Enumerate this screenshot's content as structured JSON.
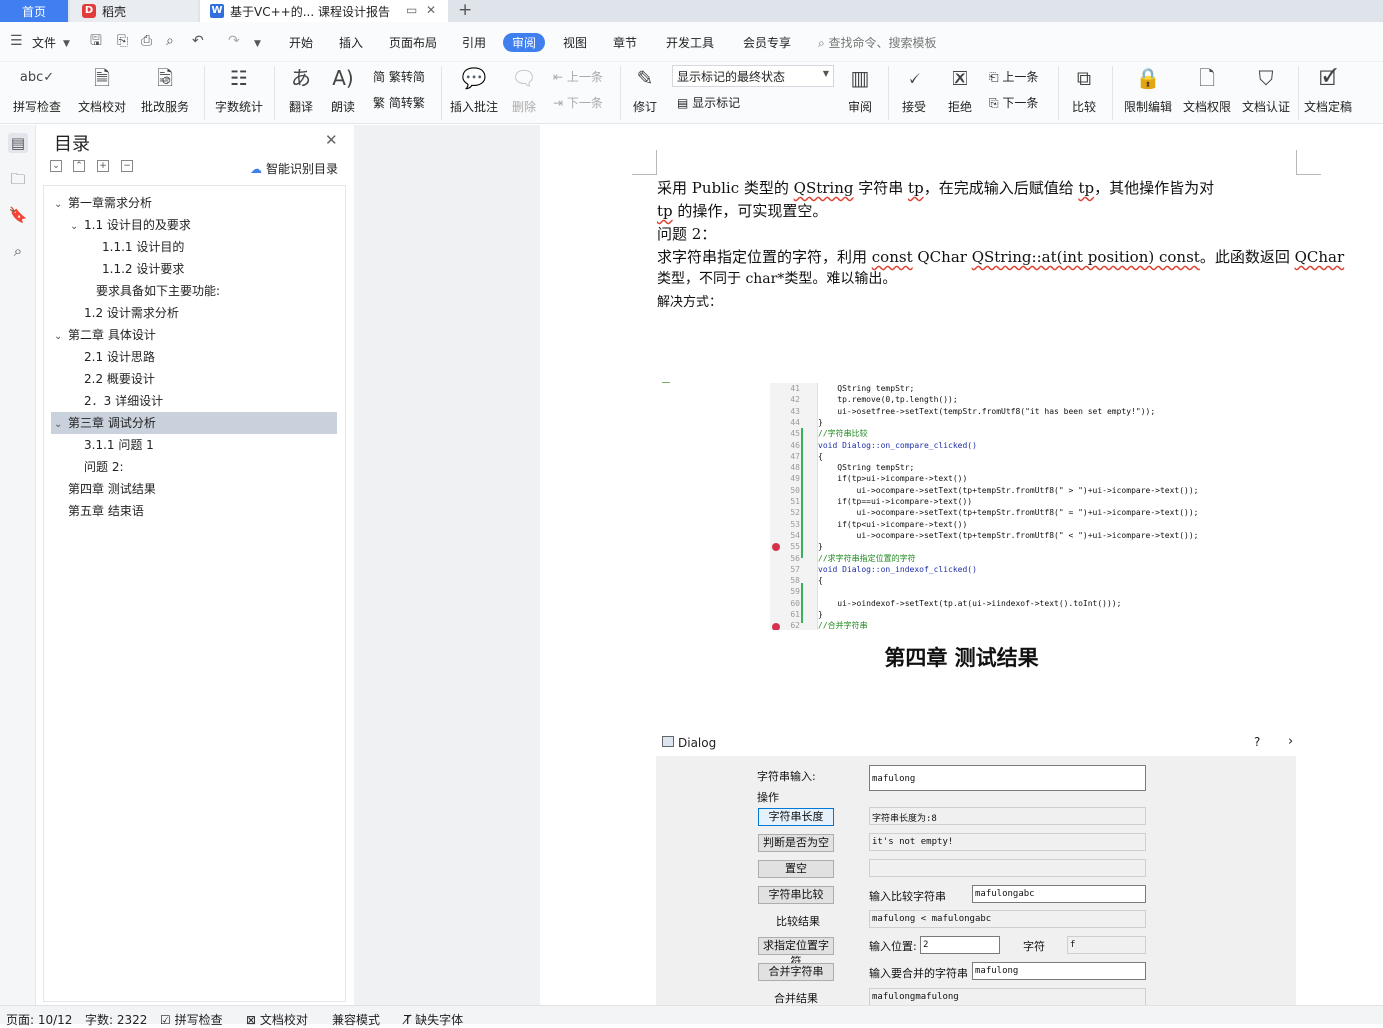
{
  "tabs": {
    "home": "首页",
    "daoke": "稻壳",
    "doc": "基于VC++的... 课程设计报告",
    "add": "+"
  },
  "menu": {
    "file": "文件",
    "items": [
      "开始",
      "插入",
      "页面布局",
      "引用",
      "审阅",
      "视图",
      "章节",
      "开发工具",
      "会员专享"
    ],
    "search": "查找命令、搜索模板"
  },
  "ribbon": {
    "spell_check": "拼写检查",
    "doc_proof": "文档校对",
    "revise_service": "批改服务",
    "word_count": "字数统计",
    "translate": "翻译",
    "read_aloud": "朗读",
    "trad_to_simp": "繁转简",
    "simp_to_trad": "简转繁",
    "insert_comment": "插入批注",
    "delete": "删除",
    "prev_comment": "上一条",
    "next_comment": "下一条",
    "track_changes": "修订",
    "markup_state": "显示标记的最终状态",
    "show_markup": "显示标记",
    "review_pane": "审阅",
    "accept": "接受",
    "reject": "拒绝",
    "prev_change": "上一条",
    "next_change": "下一条",
    "compare": "比较",
    "restrict_edit": "限制编辑",
    "doc_permission": "文档权限",
    "doc_certify": "文档认证",
    "doc_finalize": "文档定稿"
  },
  "toc": {
    "title": "目录",
    "smart": "智能识别目录",
    "items": [
      {
        "label": "第一章需求分析",
        "level": 0,
        "caret": "⌄"
      },
      {
        "label": "1.1 设计目的及要求",
        "level": 1,
        "caret": "⌄"
      },
      {
        "label": "1.1.1 设计目的",
        "level": 2,
        "caret": ""
      },
      {
        "label": "1.1.2 设计要求",
        "level": 2,
        "caret": ""
      },
      {
        "label": "要求具备如下主要功能:",
        "level": 3,
        "caret": ""
      },
      {
        "label": "1.2 设计需求分析",
        "level": 1,
        "caret": ""
      },
      {
        "label": "第二章  具体设计",
        "level": 0,
        "caret": "⌄"
      },
      {
        "label": "2.1 设计思路",
        "level": 1,
        "caret": ""
      },
      {
        "label": "2.2 概要设计",
        "level": 1,
        "caret": ""
      },
      {
        "label": "2．3 详细设计",
        "level": 1,
        "caret": ""
      },
      {
        "label": "第三章  调试分析",
        "level": 0,
        "caret": "⌄",
        "selected": true
      },
      {
        "label": "3.1.1 问题 1",
        "level": 1,
        "caret": ""
      },
      {
        "label": "问题 2:",
        "level": 1,
        "caret": ""
      },
      {
        "label": "第四章  测试结果",
        "level": 0,
        "caret": ""
      },
      {
        "label": "第五章  结束语",
        "level": 0,
        "caret": ""
      }
    ]
  },
  "doc": {
    "p1a_1": "采用 Public 类型的 ",
    "p1a_2": "QString",
    "p1a_3": " 字符串 ",
    "p1a_4": "tp",
    "p1a_5": "，在完成输入后赋值给 ",
    "p1a_6": "tp",
    "p1a_7": "，其他操作皆为对",
    "p1b_1": "tp",
    "p1b_2": " 的操作，可实现置空。",
    "q2": "问题 2：",
    "p2a_1": "求字符串指定位置的字符，利用 ",
    "p2a_2": "const",
    "p2a_3": " QChar ",
    "p2a_4": "QString::at(int position) const",
    "p2a_5": "。此函数返回 ",
    "p2a_6": "QChar",
    "p2b": "类型，不同于 char*类型。难以输出。",
    "solution": "解决方式：",
    "chapter4": "第四章  测试结果"
  },
  "code": [
    {
      "ln": "41",
      "t": "    QString tempStr;"
    },
    {
      "ln": "42",
      "t": "    tp.remove(0,tp.length());"
    },
    {
      "ln": "43",
      "t": "    ui->osetfree->setText(tempStr.fromUtf8(\"it has been set empty!\"));"
    },
    {
      "ln": "44",
      "t": "}"
    },
    {
      "ln": "45",
      "t": "//字符串比较"
    },
    {
      "ln": "46",
      "t": "void Dialog::on_compare_clicked()"
    },
    {
      "ln": "47",
      "t": "{"
    },
    {
      "ln": "48",
      "t": "    QString tempStr;"
    },
    {
      "ln": "49",
      "t": "    if(tp>ui->icompare->text())"
    },
    {
      "ln": "50",
      "t": "        ui->ocompare->setText(tp+tempStr.fromUtf8(\" > \")+ui->icompare->text());"
    },
    {
      "ln": "51",
      "t": "    if(tp==ui->icompare->text())"
    },
    {
      "ln": "52",
      "t": "        ui->ocompare->setText(tp+tempStr.fromUtf8(\" = \")+ui->icompare->text());"
    },
    {
      "ln": "53",
      "t": "    if(tp<ui->icompare->text())"
    },
    {
      "ln": "54",
      "t": "        ui->ocompare->setText(tp+tempStr.fromUtf8(\" < \")+ui->icompare->text());"
    },
    {
      "ln": "55",
      "t": "}"
    },
    {
      "ln": "56",
      "t": "//求字符串指定位置的字符"
    },
    {
      "ln": "57",
      "t": "void Dialog::on_indexof_clicked()"
    },
    {
      "ln": "58",
      "t": "{"
    },
    {
      "ln": "59",
      "t": ""
    },
    {
      "ln": "60",
      "t": "    ui->oindexof->setText(tp.at(ui->iindexof->text().toInt()));"
    },
    {
      "ln": "61",
      "t": "}"
    },
    {
      "ln": "62",
      "t": "//合并字符串"
    }
  ],
  "dialog": {
    "title": "Dialog",
    "help": "?",
    "close": "›",
    "input_label": "字符串输入:",
    "input_value": "mafulong",
    "ops_label": "操作",
    "btn_length": "字符串长度",
    "out_length": "字符串长度为:8",
    "btn_empty": "判断是否为空",
    "out_empty": "it's not empty!",
    "btn_clear": "置空",
    "out_clear": "",
    "btn_compare": "字符串比较",
    "compare_label": "输入比较字符串",
    "compare_value": "mafulongabc",
    "result_label": "比较结果",
    "result_value": "mafulong < mafulongabc",
    "btn_index": "求指定位置字符",
    "pos_label": "输入位置:",
    "pos_value": "2",
    "char_label": "字符",
    "char_value": "f",
    "btn_merge": "合并字符串",
    "merge_label": "输入要合并的字符串",
    "merge_value": "mafulong",
    "merged_label": "合并结果",
    "merged_value": "mafulongmafulong"
  },
  "status": {
    "page": "页面: 10/12",
    "words": "字数: 2322",
    "spell": "拼写检查",
    "proof": "文档校对",
    "compat": "兼容模式",
    "missing_font": "缺失字体"
  },
  "colors": {
    "accent": "#3f7ff0",
    "toc_selected": "#c9d1dc",
    "spell_underline": "#dd4433"
  }
}
